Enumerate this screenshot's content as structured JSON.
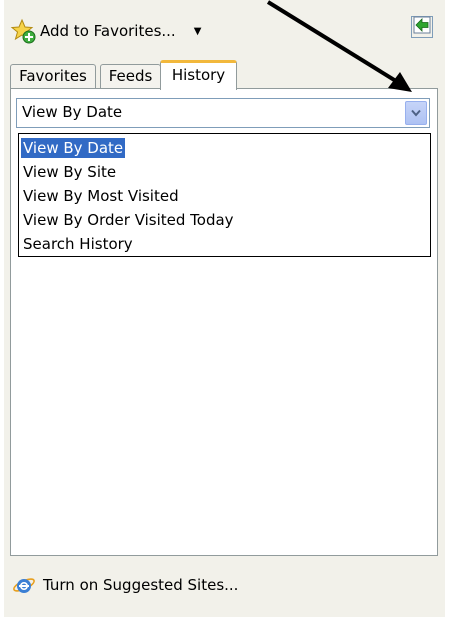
{
  "toolbar": {
    "add_favorites_label": "Add to Favorites...",
    "dropdown_arrow": "▼"
  },
  "tabs": [
    {
      "label": "Favorites",
      "active": false
    },
    {
      "label": "Feeds",
      "active": false
    },
    {
      "label": "History",
      "active": true
    }
  ],
  "history": {
    "view_combo_value": "View By Date",
    "options": [
      "View By Date",
      "View By Site",
      "View By Most Visited",
      "View By Order Visited Today",
      "Search History"
    ],
    "selected_index": 0
  },
  "footer": {
    "suggested_sites_label": "Turn on Suggested Sites..."
  },
  "colors": {
    "panel_bg": "#f2f1ea",
    "active_tab_accent": "#f2b83c",
    "selection_bg": "#316ac5",
    "combo_border": "#7f9db9"
  },
  "icons": {
    "add_favorites": "star-plus-icon",
    "pin": "green-arrow-pin-icon",
    "combo_button": "chevron-down-icon",
    "footer": "internet-explorer-icon"
  }
}
